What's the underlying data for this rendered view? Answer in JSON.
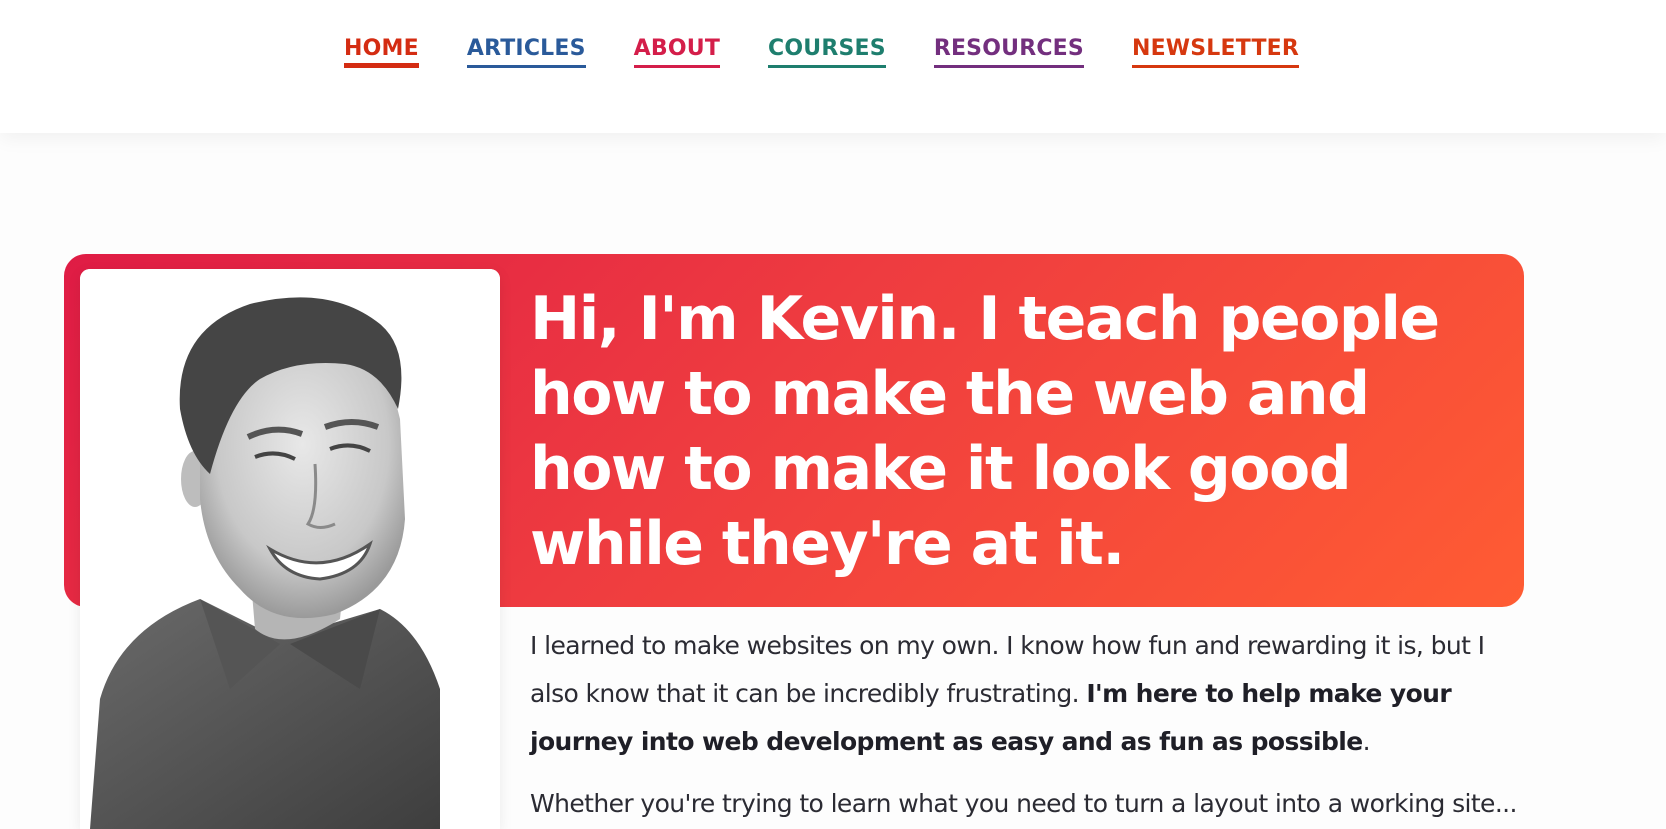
{
  "nav": {
    "items": [
      {
        "label": "HOME",
        "color": "#d42c12",
        "active": true
      },
      {
        "label": "ARTICLES",
        "color": "#2a5a9a"
      },
      {
        "label": "ABOUT",
        "color": "#d41e4a"
      },
      {
        "label": "COURSES",
        "color": "#1e7e6e"
      },
      {
        "label": "RESOURCES",
        "color": "#732f7e"
      },
      {
        "label": "NEWSLETTER",
        "color": "#d6380f"
      }
    ]
  },
  "hero": {
    "heading": "Hi, I'm Kevin. I teach people how to make the web and how to make it look good while they're at it.",
    "gradient_start": "#df1c45",
    "gradient_end": "#ff5c33",
    "photo_icon": "portrait-photo"
  },
  "intro": {
    "text_plain": "I learned to make websites on my own. I know how fun and rewarding it is, but I also know that it can be incredibly frustrating. ",
    "text_bold": "I'm here to help make your journey into web development as easy and as fun as possible",
    "text_end": ".",
    "next_line": "Whether you're trying to learn what you need to turn a layout into a working site..."
  }
}
